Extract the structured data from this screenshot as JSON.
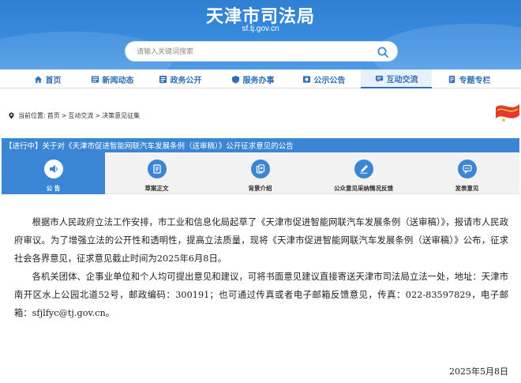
{
  "header": {
    "site_title": "天津市司法局",
    "site_url": "sf.tj.gov.cn",
    "search_placeholder": "请输入关键词搜索"
  },
  "nav": {
    "items": [
      {
        "label": "首页",
        "icon": "home-icon"
      },
      {
        "label": "新闻动态",
        "icon": "news-icon"
      },
      {
        "label": "政务公开",
        "icon": "info-icon"
      },
      {
        "label": "服务办事",
        "icon": "service-icon"
      },
      {
        "label": "公示公告",
        "icon": "notice-icon"
      },
      {
        "label": "互动交流",
        "icon": "interact-icon",
        "active": true
      },
      {
        "label": "专题专栏",
        "icon": "topic-icon"
      }
    ]
  },
  "breadcrumb": {
    "prefix": "当前位置:",
    "items": [
      "首页",
      "互动交流",
      "决策意见征集"
    ]
  },
  "notice_title": "【进行中】关于对《天津市促进智能网联汽车发展条例（送审稿）》公开征求意见的公告",
  "tabs": [
    {
      "label": "公 告",
      "icon": "speaker-icon",
      "active": true
    },
    {
      "label": "草案正文",
      "icon": "document-icon"
    },
    {
      "label": "背景介绍",
      "icon": "files-icon"
    },
    {
      "label": "公众意见采纳情况反馈",
      "icon": "pen-icon"
    },
    {
      "label": "发表意见",
      "icon": "chat-icon"
    }
  ],
  "content": {
    "paragraphs": [
      "根据市人民政府立法工作安排，市工业和信息化局起草了《天津市促进智能网联汽车发展条例（送审稿）》，报请市人民政府审议。为了增强立法的公开性和透明性，提高立法质量，现将《天津市促进智能网联汽车发展条例（送审稿）》公布，征求社会各界意见，征求意见截止时间为2025年6月8日。",
      "各机关团体、企事业单位和个人均可提出意见和建议，可将书面意见建议直接寄送天津市司法局立法一处，地址：天津市南开区水上公园北道52号，邮政编码：300191；也可通过传真或者电子邮箱反馈意见，传真：022-83597829，电子邮箱：sfjlfyc@tj.gov.cn。"
    ],
    "date": "2025年5月8日"
  },
  "colors": {
    "brand_blue": "#3a86d4",
    "nav_text": "#2e6fb7"
  }
}
